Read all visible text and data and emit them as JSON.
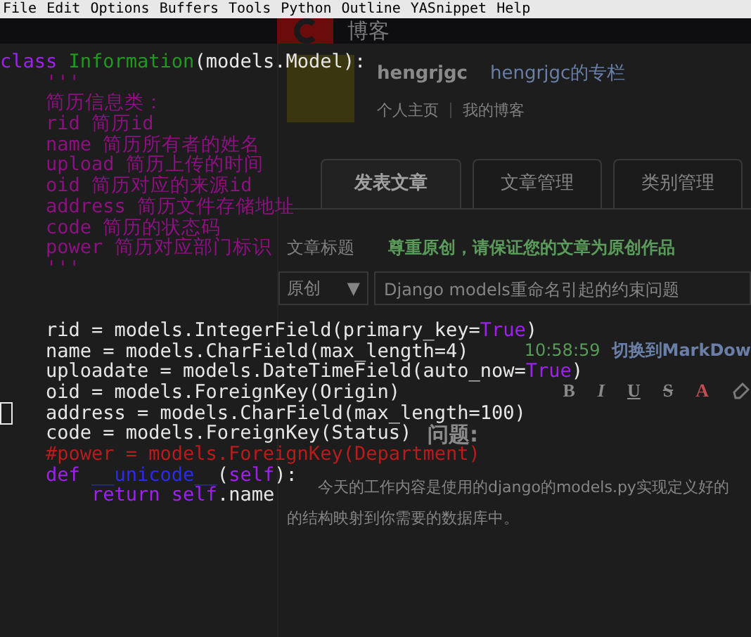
{
  "menu_bar": [
    "File",
    "Edit",
    "Options",
    "Buffers",
    "Tools",
    "Python",
    "Outline",
    "YASnippet",
    "Help"
  ],
  "background_page": {
    "site_title": "博客",
    "author": "hengrjgc",
    "column_link": "hengrjgc的专栏",
    "profile_links": [
      "个人主页",
      "我的博客"
    ],
    "tabs": [
      {
        "label": "发表文章",
        "selected": true
      },
      {
        "label": "文章管理",
        "selected": false
      },
      {
        "label": "类别管理",
        "selected": false
      }
    ],
    "title_label": "文章标题",
    "notice": "尊重原创，请保证您的文章为原创作品",
    "type_select": "原创",
    "select_caret": "▼",
    "title_value": "Django models重命名引起的约束问题",
    "autosave_time": "10:58:59",
    "markdown_link": "切换到MarkDow",
    "toolbar": [
      {
        "glyph": "B",
        "kind": "bold"
      },
      {
        "glyph": "I",
        "kind": "italic"
      },
      {
        "glyph": "U",
        "kind": "underline"
      },
      {
        "glyph": "S",
        "kind": "strike"
      },
      {
        "glyph": "A",
        "kind": "color"
      }
    ],
    "section_heading": "问题:",
    "paragraph_lines": [
      "今天的工作内容是使用的django的models.py实现定义好的",
      "的结构映射到你需要的数据库中。"
    ]
  },
  "editor": {
    "lines": [
      {
        "kind": "code",
        "cursor": false,
        "tokens": [
          {
            "text": "class ",
            "kind": "keyword"
          },
          {
            "text": "Information",
            "kind": "class-name"
          },
          {
            "text": "(models.Model):",
            "kind": "plain"
          }
        ],
        "children": [
          {
            "kind": "code",
            "cursor": false,
            "tokens": [
              {
                "text": "'''",
                "kind": "docstring"
              }
            ]
          },
          {
            "kind": "code",
            "cursor": false,
            "tokens": [
              {
                "text": "简历信息类：",
                "kind": "docstring"
              }
            ]
          },
          {
            "kind": "code",
            "cursor": false,
            "tokens": [
              {
                "text": "rid 简历id",
                "kind": "docstring"
              }
            ]
          },
          {
            "kind": "code",
            "cursor": false,
            "tokens": [
              {
                "text": "name 简历所有者的姓名",
                "kind": "docstring"
              }
            ]
          },
          {
            "kind": "code",
            "cursor": false,
            "tokens": [
              {
                "text": "upload 简历上传的时间",
                "kind": "docstring"
              }
            ]
          },
          {
            "kind": "code",
            "cursor": false,
            "tokens": [
              {
                "text": "oid 简历对应的来源id",
                "kind": "docstring"
              }
            ]
          },
          {
            "kind": "code",
            "cursor": false,
            "tokens": [
              {
                "text": "address 简历文件存储地址",
                "kind": "docstring"
              }
            ]
          },
          {
            "kind": "code",
            "cursor": false,
            "tokens": [
              {
                "text": "code 简历的状态码",
                "kind": "docstring"
              }
            ]
          },
          {
            "kind": "code",
            "cursor": false,
            "tokens": [
              {
                "text": "power 简历对应部门标识",
                "kind": "docstring"
              }
            ]
          },
          {
            "kind": "code",
            "cursor": false,
            "tokens": [
              {
                "text": "'''",
                "kind": "docstring"
              }
            ]
          },
          {
            "kind": "blank",
            "cursor": false
          },
          {
            "kind": "blank",
            "cursor": false
          },
          {
            "kind": "code",
            "cursor": false,
            "tokens": [
              {
                "text": "rid = models.IntegerField(primary_key=",
                "kind": "plain"
              },
              {
                "text": "True",
                "kind": "constant"
              },
              {
                "text": ")",
                "kind": "plain"
              }
            ]
          },
          {
            "kind": "code",
            "cursor": false,
            "tokens": [
              {
                "text": "name = models.CharField(max_length=4)",
                "kind": "plain"
              }
            ]
          },
          {
            "kind": "code",
            "cursor": false,
            "tokens": [
              {
                "text": "uploadate = models.DateTimeField(auto_now=",
                "kind": "plain"
              },
              {
                "text": "True",
                "kind": "constant"
              },
              {
                "text": ")",
                "kind": "plain"
              }
            ]
          },
          {
            "kind": "code",
            "cursor": false,
            "tokens": [
              {
                "text": "oid = models.ForeignKey(Origin)",
                "kind": "plain"
              }
            ]
          },
          {
            "kind": "code",
            "cursor": true,
            "tokens": [
              {
                "text": "address = models.CharField(max_length=100)",
                "kind": "plain"
              }
            ]
          },
          {
            "kind": "code",
            "cursor": false,
            "tokens": [
              {
                "text": "code = models.ForeignKey(Status)",
                "kind": "plain"
              }
            ]
          },
          {
            "kind": "code",
            "cursor": false,
            "tokens": [
              {
                "text": "#power = models.ForeignKey(Department)",
                "kind": "comment"
              }
            ]
          },
          {
            "kind": "code",
            "cursor": false,
            "tokens": [
              {
                "text": "def ",
                "kind": "keyword"
              },
              {
                "text": "__unicode__",
                "kind": "function-name"
              },
              {
                "text": "(",
                "kind": "plain"
              },
              {
                "text": "self",
                "kind": "keyword"
              },
              {
                "text": "):",
                "kind": "plain"
              }
            ],
            "children": [
              {
                "kind": "code",
                "cursor": false,
                "tokens": [
                  {
                    "text": "return ",
                    "kind": "keyword"
                  },
                  {
                    "text": "self",
                    "kind": "keyword"
                  },
                  {
                    "text": ".name",
                    "kind": "plain"
                  }
                ]
              }
            ]
          }
        ]
      }
    ]
  }
}
